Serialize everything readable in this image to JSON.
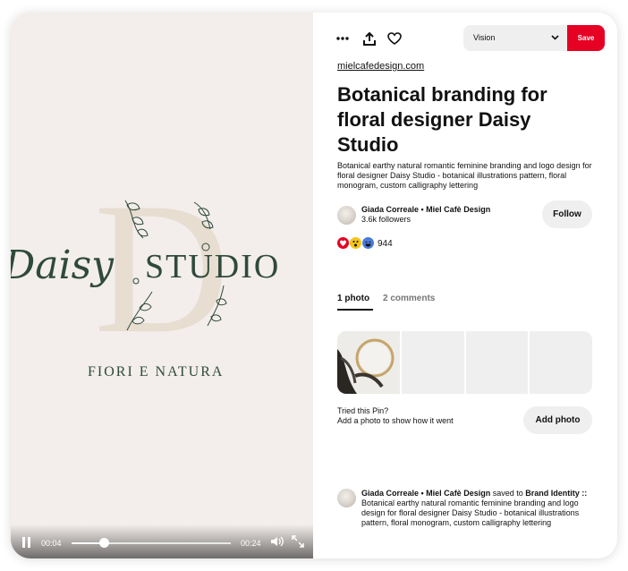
{
  "media": {
    "logo_script": "Daisy",
    "logo_serif": "STUDIO",
    "logo_letter": "D",
    "tagline": "FIORI E NATURA",
    "time_current": "00:04",
    "time_total": "00:24",
    "progress": 0.2,
    "colors": {
      "background": "#f3eeeb",
      "ink": "#2f4a3a",
      "monogram": "#e7ddd0"
    }
  },
  "toolbar": {
    "more_icon": "more-dots-icon",
    "share_icon": "share-upload-icon",
    "react_icon": "heart-icon",
    "board_value": "Vision",
    "save_label": "Save"
  },
  "pin": {
    "source": "mielcafedesign.com",
    "title": "Botanical branding for floral designer Daisy Studio",
    "description": "Botanical earthy natural romantic feminine branding and logo design for floral designer Daisy Studio - botanical illustrations pattern, floral monogram, custom calligraphy lettering"
  },
  "creator": {
    "name": "Giada Correale • Miel Cafè Design",
    "followers": "3.6k followers",
    "follow_label": "Follow"
  },
  "reactions": {
    "count": "944",
    "colors": [
      "#e60023",
      "#f5c518",
      "#4a7bd8"
    ]
  },
  "tabs": [
    {
      "label": "1 photo",
      "active": true
    },
    {
      "label": "2 comments",
      "active": false
    }
  ],
  "tried": {
    "question": "Tried this Pin?",
    "hint": "Add a photo to show how it went",
    "button_label": "Add photo"
  },
  "activity": {
    "user": "Giada Correale • Miel Cafè Design",
    "action": "saved to",
    "board": "Brand Identity ::",
    "description": "Botanical earthy natural romantic feminine branding and logo design for floral designer Daisy Studio - botanical illustrations pattern, floral monogram, custom calligraphy lettering"
  },
  "accent_color": "#e60023"
}
